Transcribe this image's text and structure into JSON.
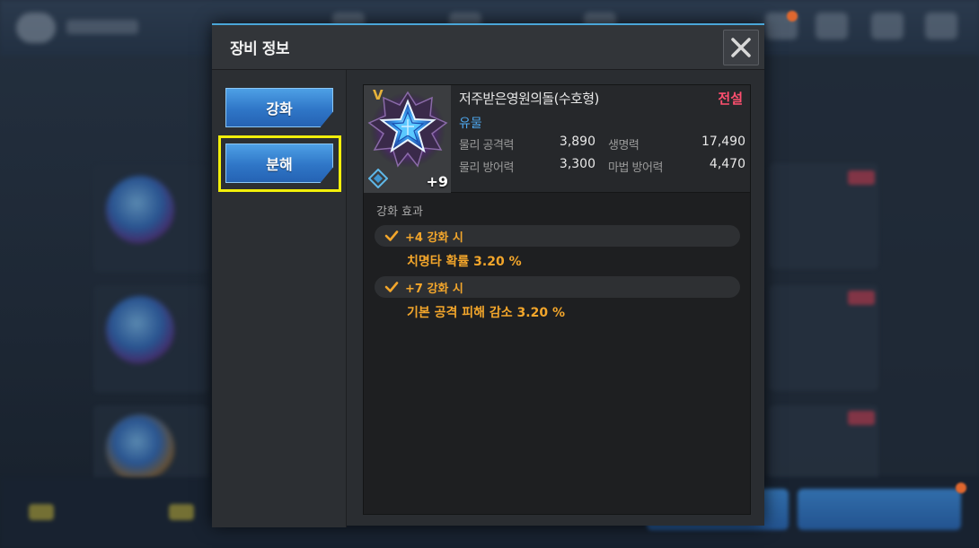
{
  "modal": {
    "title": "장비 정보",
    "close_icon": "close-x-icon"
  },
  "menu": {
    "enhance_label": "강화",
    "disassemble_label": "분해",
    "highlighted": "분해"
  },
  "item": {
    "grade_mark": "V",
    "enhance_level": "+9",
    "name": "저주받은영원의돌(수호형)",
    "grade": "전설",
    "type": "유물",
    "icon": "blue-star-stone-icon",
    "stats": [
      {
        "label": "물리 공격력",
        "value": "3,890"
      },
      {
        "label": "생명력",
        "value": "17,490"
      },
      {
        "label": "물리 방어력",
        "value": "3,300"
      },
      {
        "label": "마법 방어력",
        "value": "4,470"
      }
    ]
  },
  "effects": {
    "title": "강화 효과",
    "list": [
      {
        "level": "+4 강화 시",
        "desc": "치명타 확률  3.20 %"
      },
      {
        "level": "+7 강화 시",
        "desc": "기본 공격 피해 감소  3.20 %"
      }
    ]
  },
  "colors": {
    "accent_blue": "#2f76c7",
    "legend_red": "#ff4f6f",
    "effect_orange": "#f3a62b",
    "highlight_yellow": "#f2ef0a",
    "relic_blue": "#4ea7ee"
  }
}
